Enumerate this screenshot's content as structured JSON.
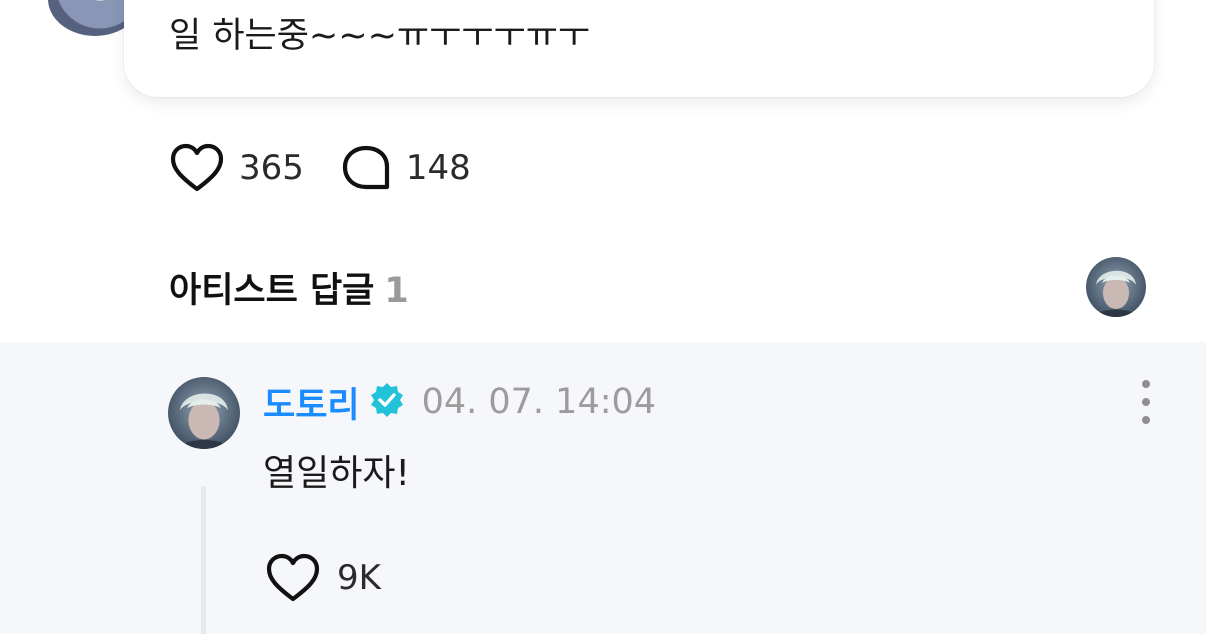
{
  "post": {
    "text": "일 하는중~~~ㅠㅜㅜㅜㅠㅜ",
    "like_count": "365",
    "comment_count": "148"
  },
  "artist_replies": {
    "title": "아티스트 답글",
    "count": "1"
  },
  "reply": {
    "author": "도토리",
    "verified": true,
    "timestamp": "04. 07. 14:04",
    "text": "열일하자!",
    "like_count": "9K"
  },
  "colors": {
    "author_name": "#1a8cff",
    "verified_badge": "#22c3d8",
    "muted_text": "#9c9c9c",
    "reply_background": "#f6f7fa"
  },
  "icons": {
    "like": "heart-outline-icon",
    "comment": "speech-bubble-icon",
    "verified": "verified-badge-icon",
    "more": "more-vertical-icon"
  }
}
